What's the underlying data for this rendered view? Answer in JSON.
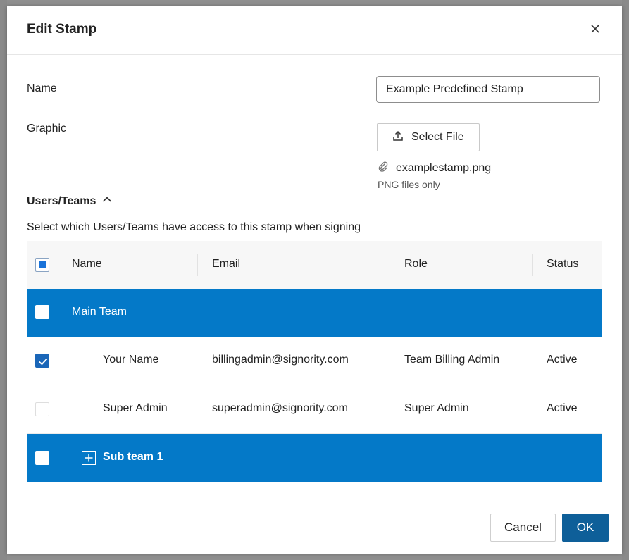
{
  "dialog": {
    "title": "Edit Stamp"
  },
  "form": {
    "name_label": "Name",
    "name_value": "Example Predefined Stamp",
    "graphic_label": "Graphic",
    "select_file_label": "Select File",
    "file_name": "examplestamp.png",
    "file_hint": "PNG files only"
  },
  "users": {
    "section_label": "Users/Teams",
    "description": "Select which Users/Teams have access to this stamp when signing",
    "columns": [
      "Name",
      "Email",
      "Role",
      "Status"
    ],
    "rows": [
      {
        "type": "team",
        "name": "Main Team",
        "checked": false
      },
      {
        "type": "user",
        "name": "Your Name",
        "email": "billingadmin@signority.com",
        "role": "Team Billing Admin",
        "status": "Active",
        "checked": true
      },
      {
        "type": "user",
        "name": "Super Admin",
        "email": "superadmin@signority.com",
        "role": "Super Admin",
        "status": "Active",
        "checked": false
      },
      {
        "type": "subteam",
        "name": "Sub team 1",
        "checked": false
      }
    ]
  },
  "footer": {
    "cancel_label": "Cancel",
    "ok_label": "OK"
  },
  "colors": {
    "team_row": "#0479c8",
    "ok_button": "#0e5f99",
    "checkbox_checked": "#1a66b8"
  }
}
